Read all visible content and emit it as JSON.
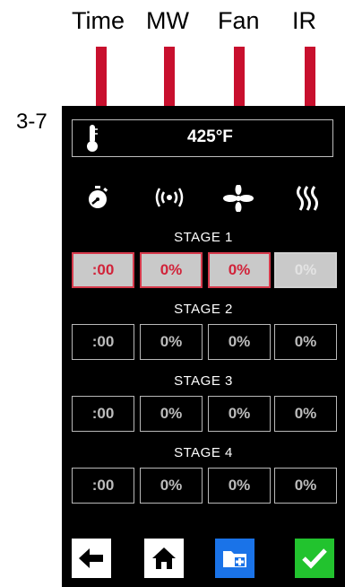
{
  "annotations": {
    "columns": [
      "Time",
      "MW",
      "Fan",
      "IR"
    ],
    "reference": "3-7",
    "arrow_color": "#c8102e"
  },
  "header": {
    "temperature": "425°F"
  },
  "icons": [
    "stopwatch-icon",
    "microwave-icon",
    "fan-icon",
    "ir-heat-icon"
  ],
  "stages": [
    {
      "label": "STAGE 1",
      "values": [
        ":00",
        "0%",
        "0%",
        "0%"
      ],
      "state": "active"
    },
    {
      "label": "STAGE 2",
      "values": [
        ":00",
        "0%",
        "0%",
        "0%"
      ],
      "state": "inactive"
    },
    {
      "label": "STAGE 3",
      "values": [
        ":00",
        "0%",
        "0%",
        "0%"
      ],
      "state": "inactive"
    },
    {
      "label": "STAGE 4",
      "values": [
        ":00",
        "0%",
        "0%",
        "0%"
      ],
      "state": "inactive"
    }
  ],
  "footer": {
    "buttons": [
      "back-arrow-icon",
      "home-icon",
      "save-to-folder-icon",
      "confirm-check-icon"
    ],
    "colors": {
      "back": "#ffffff",
      "home": "#ffffff",
      "save": "#1a73e8",
      "confirm": "#22c32e"
    }
  },
  "colors": {
    "active_border": "#d63a4c",
    "active_text": "#d1233a",
    "screen_bg": "#000000"
  }
}
